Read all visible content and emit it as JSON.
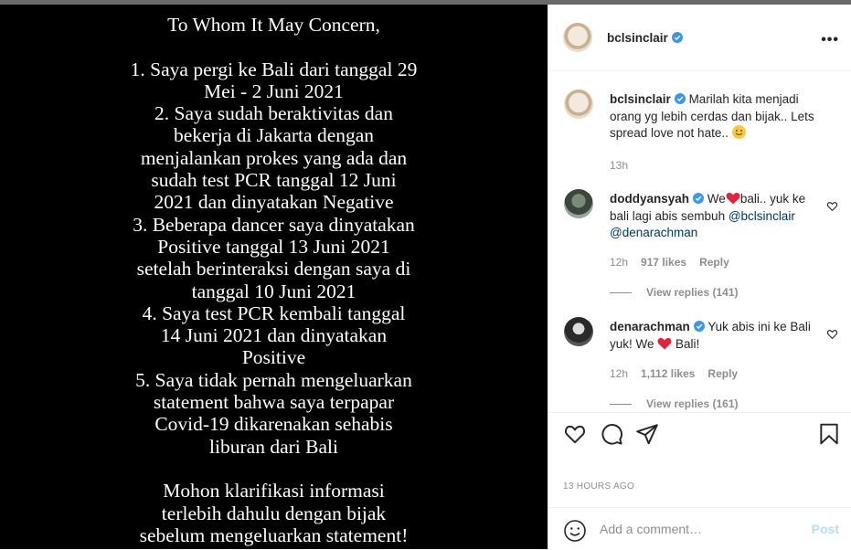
{
  "post": {
    "letter_lines": [
      "To Whom It May Concern,",
      "",
      "1. Saya pergi ke Bali dari tanggal 29",
      "Mei - 2 Juni 2021",
      "2. Saya sudah beraktivitas dan",
      "bekerja di Jakarta dengan",
      "menjalankan prokes yang ada dan",
      "sudah test PCR tanggal 12 Juni",
      "2021 dan dinyatakan Negative",
      "3. Beberapa dancer saya dinyatakan",
      "Positive tanggal 13 Juni 2021",
      "setelah berinteraksi dengan saya di",
      "tanggal 10 Juni 2021",
      "4. Saya test PCR kembali tanggal",
      "14 Juni 2021 dan dinyatakan",
      "Positive",
      "5. Saya tidak pernah mengeluarkan",
      "statement bahwa saya terpapar",
      "Covid-19 dikarenakan sehabis",
      "liburan dari Bali",
      "",
      "Mohon klarifikasi informasi",
      "terlebih dahulu dengan bijak",
      "sebelum mengeluarkan statement!"
    ]
  },
  "header": {
    "username": "bclsinclair",
    "more_label": "•••"
  },
  "caption": {
    "username": "bclsinclair",
    "text": "Marilah kita menjadi orang yg lebih cerdas dan bijak.. Lets spread love not hate..",
    "emoji_icon": "smiling-face-icon",
    "time": "13h"
  },
  "comments": [
    {
      "username": "doddyansyah",
      "text_pre": "We",
      "text_post": "bali.. yuk ke bali lagi abis sembuh",
      "mentions": "@bclsinclair @denarachman",
      "time": "12h",
      "likes": "917 likes",
      "reply": "Reply",
      "view_replies": "View replies (141)"
    },
    {
      "username": "denarachman",
      "text_pre": "Yuk abis ini ke Bali yuk! We",
      "text_post": "Bali!",
      "time": "12h",
      "likes": "1,112 likes",
      "reply": "Reply",
      "view_replies": "View replies (161)"
    }
  ],
  "footer": {
    "timestamp": "13 HOURS AGO",
    "add_comment_placeholder": "Add a comment…",
    "post_label": "Post"
  },
  "colors": {
    "verified": "#3897f0",
    "heart": "#ed4956",
    "link": "#00376b",
    "post_disabled": "#b2dffc"
  }
}
